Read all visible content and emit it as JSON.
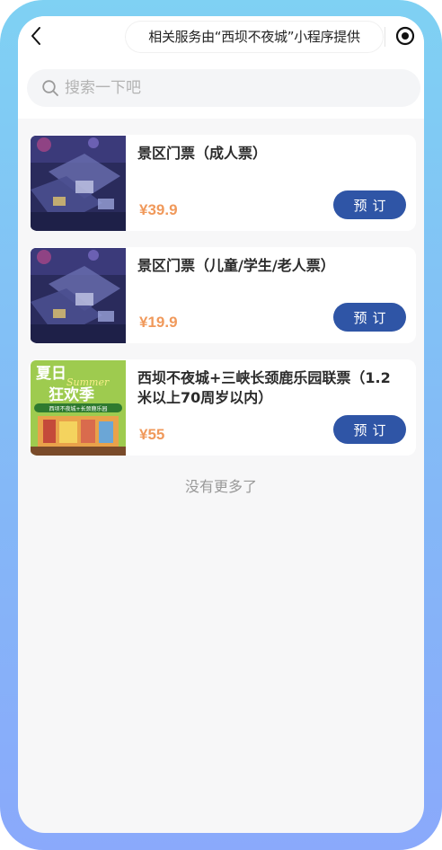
{
  "topbar": {
    "provider_text": "相关服务由“西坝不夜城”小程序提供"
  },
  "search": {
    "placeholder": "搜索一下吧"
  },
  "tickets": [
    {
      "title": "景区门票（成人票）",
      "price": "¥39.9",
      "button": "预订"
    },
    {
      "title": "景区门票（儿童/学生/老人票）",
      "price": "¥19.9",
      "button": "预订"
    },
    {
      "title": "西坝不夜城+三峡长颈鹿乐园联票（1.2米以上70周岁以内）",
      "price": "¥55",
      "button": "预订",
      "poster": {
        "line1": "夏日",
        "line2": "狂欢季",
        "script": "Summer",
        "banner": "西坝不夜城+长颈鹿乐园"
      }
    }
  ],
  "footer": {
    "no_more": "没有更多了"
  },
  "colors": {
    "button": "#2f55a6",
    "price": "#f0995b",
    "frame": "#7fd1f3"
  }
}
